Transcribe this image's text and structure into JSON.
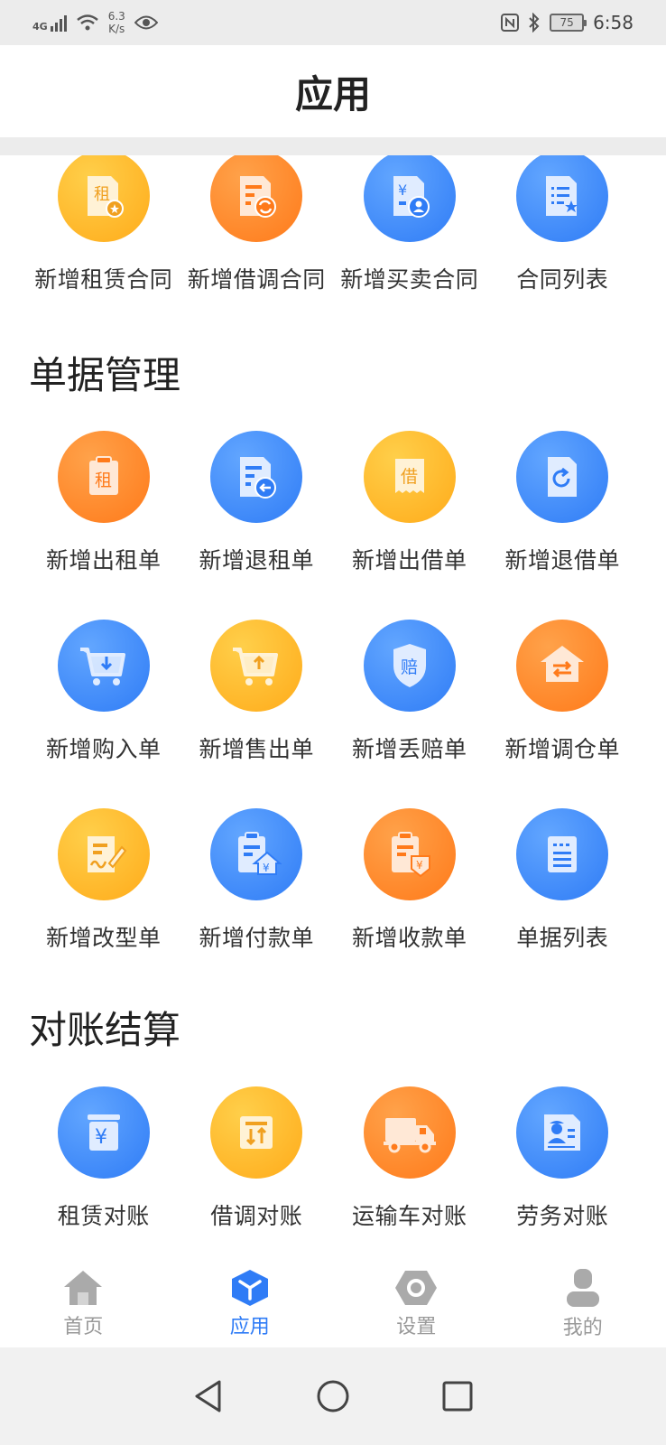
{
  "status_bar": {
    "network": "4G",
    "speed_value": "6.3",
    "speed_unit": "K/s",
    "battery": "75",
    "time": "6:58"
  },
  "header": {
    "title": "应用"
  },
  "contracts": {
    "items": [
      {
        "label": "新增租赁合同",
        "color": "yellow",
        "icon": "lease-contract-icon"
      },
      {
        "label": "新增借调合同",
        "color": "orange",
        "icon": "loan-contract-icon"
      },
      {
        "label": "新增买卖合同",
        "color": "blue",
        "icon": "sale-contract-icon"
      },
      {
        "label": "合同列表",
        "color": "blue",
        "icon": "contract-list-icon"
      }
    ]
  },
  "documents": {
    "title": "单据管理",
    "items": [
      {
        "label": "新增出租单",
        "color": "orange",
        "icon": "rent-out-icon",
        "glyph": "租"
      },
      {
        "label": "新增退租单",
        "color": "blue",
        "icon": "rent-return-icon"
      },
      {
        "label": "新增出借单",
        "color": "yellow",
        "icon": "lend-out-icon",
        "glyph": "借"
      },
      {
        "label": "新增退借单",
        "color": "blue",
        "icon": "lend-return-icon"
      },
      {
        "label": "新增购入单",
        "color": "blue",
        "icon": "purchase-cart-icon"
      },
      {
        "label": "新增售出单",
        "color": "yellow",
        "icon": "sale-cart-icon"
      },
      {
        "label": "新增丢赔单",
        "color": "blue",
        "icon": "loss-compensation-icon",
        "glyph": "赔"
      },
      {
        "label": "新增调仓单",
        "color": "orange",
        "icon": "warehouse-transfer-icon"
      },
      {
        "label": "新增改型单",
        "color": "yellow",
        "icon": "modification-icon"
      },
      {
        "label": "新增付款单",
        "color": "blue",
        "icon": "payment-icon",
        "glyph": "¥"
      },
      {
        "label": "新增收款单",
        "color": "orange",
        "icon": "receipt-icon",
        "glyph": "¥"
      },
      {
        "label": "单据列表",
        "color": "blue",
        "icon": "document-list-icon"
      }
    ]
  },
  "reconciliation": {
    "title": "对账结算",
    "items": [
      {
        "label": "租赁对账",
        "color": "blue",
        "icon": "lease-reconcile-icon",
        "glyph": "¥"
      },
      {
        "label": "借调对账",
        "color": "yellow",
        "icon": "loan-reconcile-icon"
      },
      {
        "label": "运输车对账",
        "color": "orange",
        "icon": "truck-icon"
      },
      {
        "label": "劳务对账",
        "color": "blue",
        "icon": "labor-icon"
      }
    ]
  },
  "bottom_nav": {
    "items": [
      {
        "label": "首页",
        "icon": "home-icon",
        "active": false
      },
      {
        "label": "应用",
        "icon": "apps-cube-icon",
        "active": true
      },
      {
        "label": "设置",
        "icon": "settings-hex-icon",
        "active": false
      },
      {
        "label": "我的",
        "icon": "profile-icon",
        "active": false
      }
    ]
  },
  "colors": {
    "accent": "#2f7cf6",
    "orange": "#ff7a1a",
    "yellow": "#ffab1a",
    "blue": "#2f7cf6",
    "inactive": "#999999"
  }
}
